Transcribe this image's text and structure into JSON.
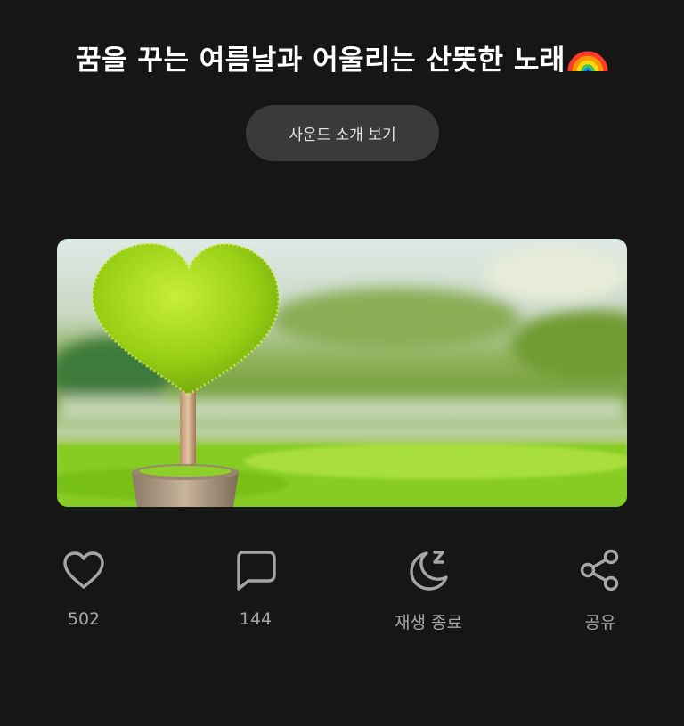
{
  "title": "꿈을 꾸는 여름날과 어울리는 산뜻한 노래",
  "title_emoji": "rainbow",
  "intro_button_label": "사운드 소개 보기",
  "actions": {
    "like": {
      "icon": "heart-icon",
      "label": "502"
    },
    "comment": {
      "icon": "speech-bubble-icon",
      "label": "144"
    },
    "sleep_timer": {
      "icon": "moon-sleep-icon",
      "label": "재생 종료"
    },
    "share": {
      "icon": "share-icon",
      "label": "공유"
    }
  },
  "colors": {
    "background": "#161616",
    "button_bg": "#3a3a3a",
    "icon_gray": "#a6a6a6",
    "text_white": "#ffffff"
  }
}
